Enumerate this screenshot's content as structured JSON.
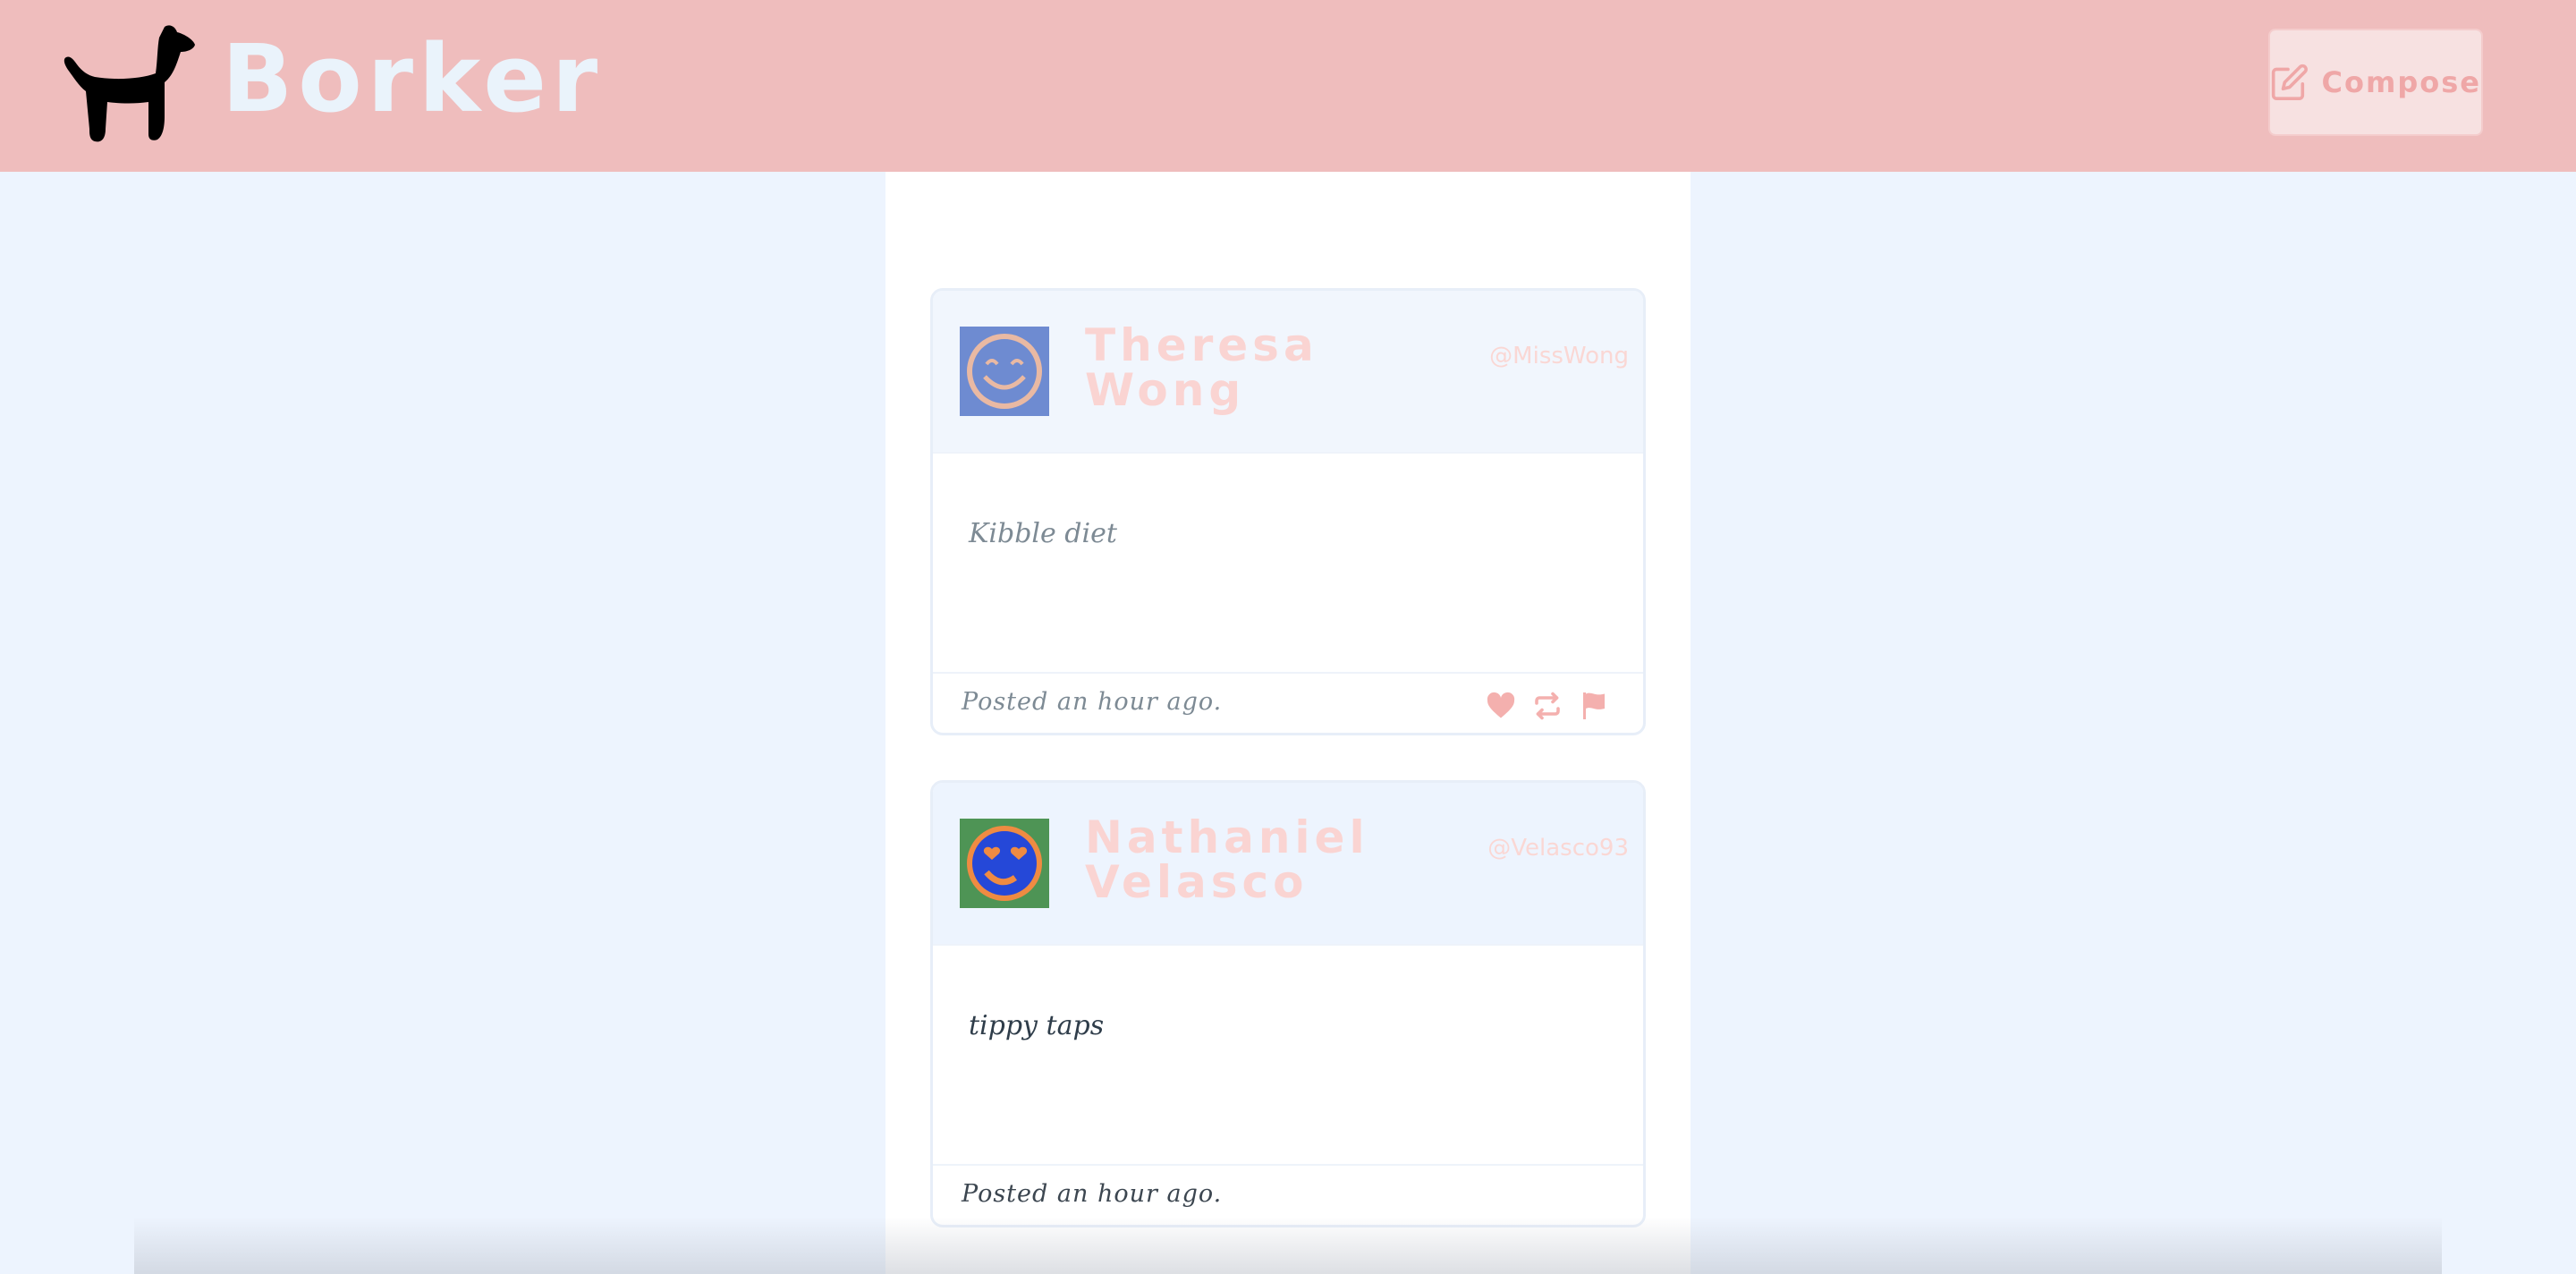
{
  "app": {
    "name": "Borker",
    "logo_icon": "dog-icon"
  },
  "header": {
    "compose_label": "Compose",
    "compose_icon": "edit-icon"
  },
  "colors": {
    "header_bg": "#efbdbd",
    "page_bg": "#edf4fe",
    "accent": "#efa7a7",
    "brand_text": "#eaf3fb"
  },
  "posts": [
    {
      "name": "Theresa Wong",
      "handle": "@MissWong",
      "avatar_icon": "smiling-face-icon",
      "text": "Kibble diet",
      "posted": "Posted an hour ago.",
      "actions": [
        "heart-icon",
        "retweet-icon",
        "flag-icon"
      ]
    },
    {
      "name": "Nathaniel Velasco",
      "handle": "@Velasco93",
      "avatar_icon": "heart-eyes-face-icon",
      "text": "tippy taps",
      "posted": "Posted an hour ago."
    }
  ]
}
